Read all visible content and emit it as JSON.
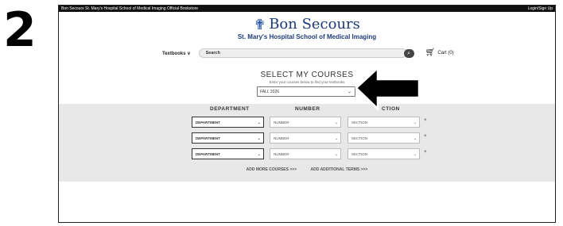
{
  "step_number": "2",
  "topbar": {
    "site_title": "Bon Secours St. Mary's Hospital School of Medical Imaging Official Bookstore",
    "login_label": "Login/Sign Up"
  },
  "logo": {
    "name": "Bon Secours",
    "subtitle": "St. Mary's Hospital School of Medical Imaging"
  },
  "nav": {
    "textbooks_label": "Textbooks ∨",
    "search_placeholder": "Search",
    "cart_label": "Cart (0)"
  },
  "courses": {
    "title": "SELECT MY COURSES",
    "subtitle": "Enter your courses below to find your textbooks",
    "term_value": "FALL 2026"
  },
  "columns": {
    "department": "DEPARTMENT",
    "number": "NUMBER",
    "section": "CTION"
  },
  "rows": [
    {
      "department": "DEPARTMENT",
      "number": "NUMBER",
      "section": "SECTION",
      "remove": "×"
    },
    {
      "department": "DEPARTMENT",
      "number": "NUMBER",
      "section": "SECTION",
      "remove": "×"
    },
    {
      "department": "DEPARTMENT",
      "number": "NUMBER",
      "section": "SECTION",
      "remove": "×"
    }
  ],
  "links": {
    "add_courses": "ADD MORE COURSES >>>",
    "add_terms": "ADD ADDITIONAL TERMS >>>"
  },
  "icons": {
    "search": "search-icon",
    "cart": "cart-icon",
    "chevron": "chevron-down-icon",
    "arrow": "arrow-left-icon"
  },
  "colors": {
    "brand": "#1e3a78",
    "band": "#e8e8e8"
  }
}
